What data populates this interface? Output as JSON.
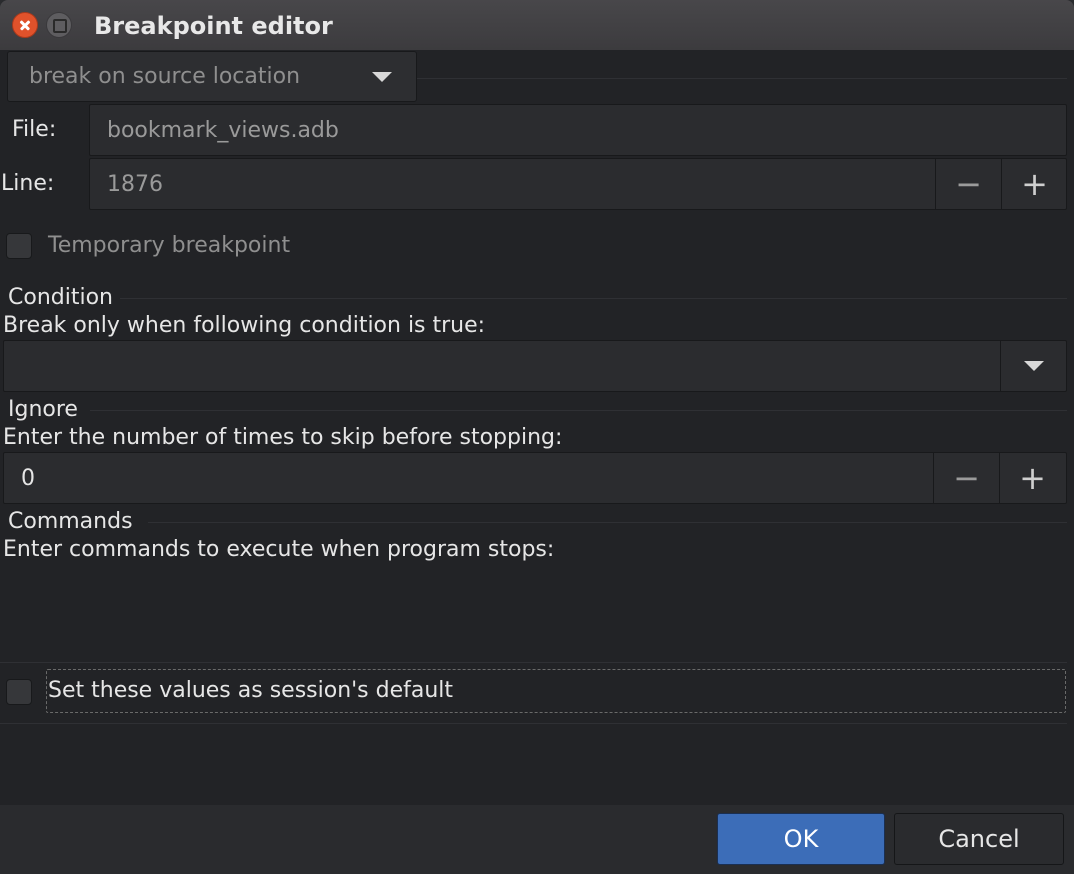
{
  "window": {
    "title": "Breakpoint editor"
  },
  "breakpoint_type": {
    "selected": "break on source location"
  },
  "file": {
    "label": "File:",
    "value": "bookmark_views.adb"
  },
  "line": {
    "label": "Line:",
    "value": "1876",
    "minus": "−",
    "plus": "+"
  },
  "temporary": {
    "label": "Temporary breakpoint",
    "checked": false
  },
  "condition": {
    "title": "Condition",
    "description": "Break only when following condition is true:",
    "value": ""
  },
  "ignore": {
    "title": "Ignore",
    "description": "Enter the number of times to skip before stopping:",
    "value": "0",
    "minus": "−",
    "plus": "+"
  },
  "commands": {
    "title": "Commands",
    "description": "Enter commands to execute when program stops:",
    "value": ""
  },
  "session_default": {
    "label": "Set these values as session's default",
    "checked": false
  },
  "buttons": {
    "ok": "OK",
    "cancel": "Cancel"
  },
  "colors": {
    "accent": "#3c6db8",
    "close": "#e0522b",
    "background": "#222326"
  }
}
